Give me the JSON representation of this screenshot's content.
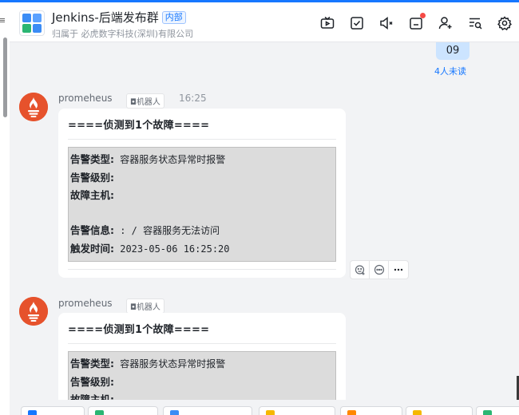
{
  "header": {
    "group_name": "Jenkins-后端发布群",
    "internal_tag": "内部",
    "subtitle": "归属于 必虎数字科技(深圳)有限公司",
    "icons": [
      "tv-icon",
      "checkbox-icon",
      "speaker-icon",
      "announcement-icon",
      "add-member-icon",
      "search-list-icon",
      "gear-icon"
    ]
  },
  "colors": {
    "accent": "#1677ff",
    "prometheus": "#e6522c",
    "bubble": "#cce4ff",
    "code_bg": "#dcdcdc"
  },
  "previous_message": {
    "text": "09",
    "read_status": "4人未读"
  },
  "messages": [
    {
      "sender": "promeheus",
      "bot_tag": "机器人",
      "time": "16:25",
      "title": "====侦测到1个故障====",
      "fields": [
        {
          "label": "告警类型:",
          "value": " 容器服务状态异常时报警"
        },
        {
          "label": "告警级别:",
          "value": ""
        },
        {
          "label": "故障主机:",
          "value": ""
        },
        {
          "label": "",
          "value": ""
        },
        {
          "label": "告警信息:",
          "value": " : / 容器服务无法访问"
        },
        {
          "label": "触发时间:",
          "value": " 2023-05-06 16:25:20"
        }
      ]
    },
    {
      "sender": "promeheus",
      "bot_tag": "机器人",
      "time": "",
      "title": "====侦测到1个故障====",
      "fields": [
        {
          "label": "告警类型:",
          "value": " 容器服务状态异常时报警"
        },
        {
          "label": "告警级别:",
          "value": ""
        },
        {
          "label": "故障主机:",
          "value": ""
        }
      ]
    }
  ],
  "message_actions": [
    "add-reaction-icon",
    "reply-icon",
    "more-icon"
  ]
}
